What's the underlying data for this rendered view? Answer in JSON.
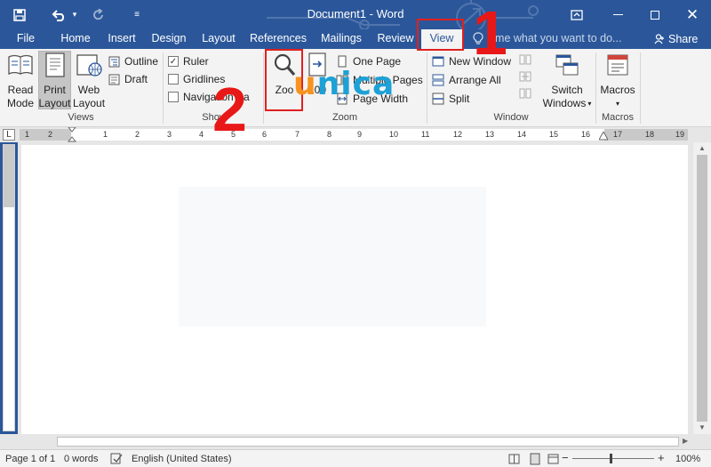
{
  "titlebar": {
    "document_title": "Document1 - Word",
    "icons": [
      "save-icon",
      "undo-icon",
      "redo-icon",
      "customize-qat-icon",
      "ribbon-display-icon",
      "minimize-icon",
      "maximize-icon",
      "close-icon"
    ]
  },
  "tabs": [
    {
      "label": "File"
    },
    {
      "label": "Home"
    },
    {
      "label": "Insert"
    },
    {
      "label": "Design"
    },
    {
      "label": "Layout"
    },
    {
      "label": "References"
    },
    {
      "label": "Mailings"
    },
    {
      "label": "Review"
    },
    {
      "label": "View",
      "active": true
    }
  ],
  "tell_me": {
    "placeholder": "ll me what you want to do..."
  },
  "share": {
    "label": "Share"
  },
  "ribbon": {
    "views": {
      "label": "Views",
      "read_mode": [
        "Read",
        "Mode"
      ],
      "print_layout": [
        "Print",
        "Layout"
      ],
      "web_layout": [
        "Web",
        "Layout"
      ],
      "outline": "Outline",
      "draft": "Draft"
    },
    "show": {
      "label": "Show",
      "ruler": "Ruler",
      "ruler_checked": true,
      "gridlines": "Gridlines",
      "navigation_pane": "Navigation Pa"
    },
    "zoom": {
      "label": "Zoom",
      "zoom": "Zoo",
      "hundred": "100",
      "one_page": "One Page",
      "multiple_pages": "Multiple Pages",
      "page_width": "Page Width"
    },
    "window": {
      "label": "Window",
      "new_window": "New Window",
      "arrange_all": "Arrange All",
      "split": "Split",
      "switch_windows": [
        "Switch",
        "Windows"
      ]
    },
    "macros": {
      "label": "Macros",
      "macros": "Macros"
    }
  },
  "ruler": {
    "corner": "L",
    "ticks": [
      "1",
      "2",
      "1",
      "2",
      "3",
      "4",
      "5",
      "6",
      "7",
      "8",
      "9",
      "10",
      "11",
      "12",
      "13",
      "14",
      "15",
      "16",
      "17",
      "18",
      "19"
    ]
  },
  "statusbar": {
    "page": "Page 1 of 1",
    "words": "0 words",
    "language": "English (United States)",
    "zoom_minus": "−",
    "zoom_plus": "+",
    "zoom_level": "100%"
  },
  "annotations": {
    "step1": "1",
    "step2": "2",
    "watermark_u": "u",
    "watermark_rest": "nica"
  },
  "colors": {
    "accent": "#2b579a",
    "annotation": "#e02020",
    "ribbon_bg": "#f3f3f3"
  }
}
